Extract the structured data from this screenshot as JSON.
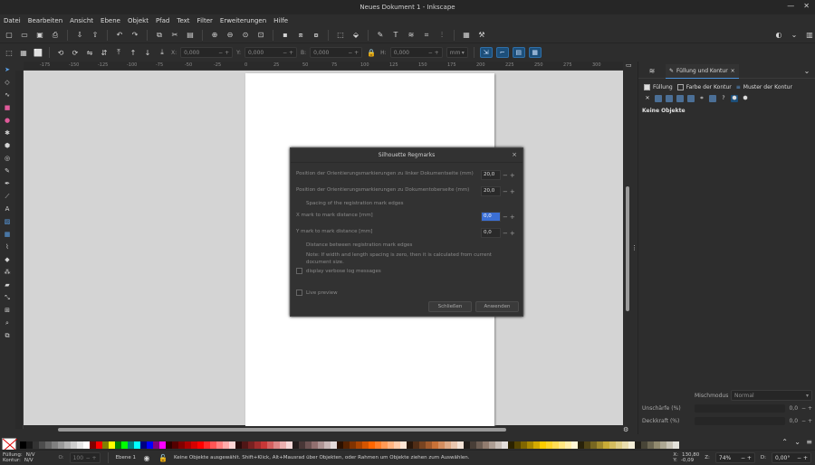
{
  "window": {
    "title": "Neues Dokument 1 - Inkscape"
  },
  "menu": [
    "Datei",
    "Bearbeiten",
    "Ansicht",
    "Ebene",
    "Objekt",
    "Pfad",
    "Text",
    "Filter",
    "Erweiterungen",
    "Hilfe"
  ],
  "toolctrl": {
    "x_label": "X:",
    "x_value": "0,000",
    "y_label": "Y:",
    "y_value": "0,000",
    "w_label": "B:",
    "w_value": "0,000",
    "h_label": "H:",
    "h_value": "0,000",
    "unit": "mm"
  },
  "ruler": {
    "ticks": [
      "-175",
      "-150",
      "-125",
      "-100",
      "-75",
      "-50",
      "-25",
      "0",
      "25",
      "50",
      "75",
      "100",
      "125",
      "150",
      "175",
      "200",
      "225",
      "250",
      "275",
      "300"
    ]
  },
  "panel": {
    "tab_active": "Füllung und Kontur",
    "subtabs": [
      "Füllung",
      "Farbe der Kontur",
      "Muster der Kontur"
    ],
    "no_objects": "Keine Objekte",
    "blend_label": "Mischmodus",
    "blend_value": "Normal",
    "blur_label": "Unschärfe (%)",
    "blur_value": "0,0",
    "opacity_label": "Deckkraft (%)",
    "opacity_value": "0,0"
  },
  "dialog": {
    "title": "Silhouette Regmarks",
    "row1_label": "Position der Orientierungsmarkierungen zu linker Dokumentseite (mm)",
    "row1_value": "20,0",
    "row2_label": "Position der Orientierungsmarkierungen zu Dokumentoberseite (mm)",
    "row2_value": "20,0",
    "heading1": "Spacing of the registration mark edges",
    "row3_label": "X mark to mark distance [mm]",
    "row3_value": "0,0",
    "row4_label": "Y mark to mark distance [mm]",
    "row4_value": "0,0",
    "heading2": "Distance between registration mark edges",
    "note": "Note: If width and length spacing is zero, then it is calculated from current document size.",
    "verbose_label": "display verbose log messages",
    "preview_label": "Live preview",
    "close_btn": "Schließen",
    "apply_btn": "Anwenden"
  },
  "status": {
    "fill_label": "Füllung:",
    "fill_value": "N/V",
    "stroke_label": "Kontur:",
    "stroke_value": "N/V",
    "opacity_label": "O:",
    "opacity_value": "100",
    "layer": "Ebene 1",
    "message": "Keine Objekte ausgewählt. Shift+Klick, Alt+Mausrad über Objekten, oder Rahmen um Objekte ziehen zum Auswählen.",
    "x_label": "X:",
    "x_value": "130,80",
    "y_label": "Y:",
    "y_value": "-0,09",
    "zoom_label": "Z:",
    "zoom_value": "74%",
    "rot_label": "D:",
    "rot_value": "0,00°"
  },
  "palette": [
    "#000000",
    "#1a1a1a",
    "#333333",
    "#4d4d4d",
    "#666666",
    "#808080",
    "#999999",
    "#b3b3b3",
    "#cccccc",
    "#e6e6e6",
    "#ffffff",
    "#800000",
    "#ff0000",
    "#808000",
    "#ffff00",
    "#008000",
    "#00ff00",
    "#008080",
    "#00ffff",
    "#000080",
    "#0000ff",
    "#800080",
    "#ff00ff",
    "#2b0000",
    "#550000",
    "#800000",
    "#aa0000",
    "#d40000",
    "#ff0000",
    "#ff2a2a",
    "#ff5555",
    "#ff8080",
    "#ffaaaa",
    "#ffd5d5",
    "#280b0b",
    "#501616",
    "#782121",
    "#a02c2c",
    "#c83737",
    "#d35f5f",
    "#de8787",
    "#e9afaf",
    "#f4d7d7",
    "#241c1c",
    "#483737",
    "#6c5353",
    "#916f6f",
    "#ac9393",
    "#c8b7b7",
    "#e3dbdb",
    "#2b1100",
    "#552200",
    "#803300",
    "#aa4400",
    "#d45500",
    "#ff6600",
    "#ff7f2a",
    "#ff9955",
    "#ffb380",
    "#ffccaa",
    "#ffe6d5",
    "#28170b",
    "#502d16",
    "#784421",
    "#a05a2c",
    "#c87137",
    "#d38d5f",
    "#deaa87",
    "#e9c6af",
    "#f4e3d7",
    "#241f1c",
    "#483e37",
    "#6c5d53",
    "#917c6f",
    "#ac9d93",
    "#c8beb7",
    "#e3dedb",
    "#2b2200",
    "#554400",
    "#806600",
    "#aa8800",
    "#d4aa00",
    "#ffcc00",
    "#ffd42a",
    "#ffdd55",
    "#ffe680",
    "#ffeeaa",
    "#fff6d5",
    "#28220b",
    "#504416",
    "#786721",
    "#a0892c",
    "#c8ab37",
    "#d3bc5f",
    "#decd87",
    "#e9ddaf",
    "#f4eed7",
    "#24221c",
    "#484537",
    "#6c6753",
    "#918a6f",
    "#aca793",
    "#c8c4b7",
    "#e3e2db"
  ]
}
